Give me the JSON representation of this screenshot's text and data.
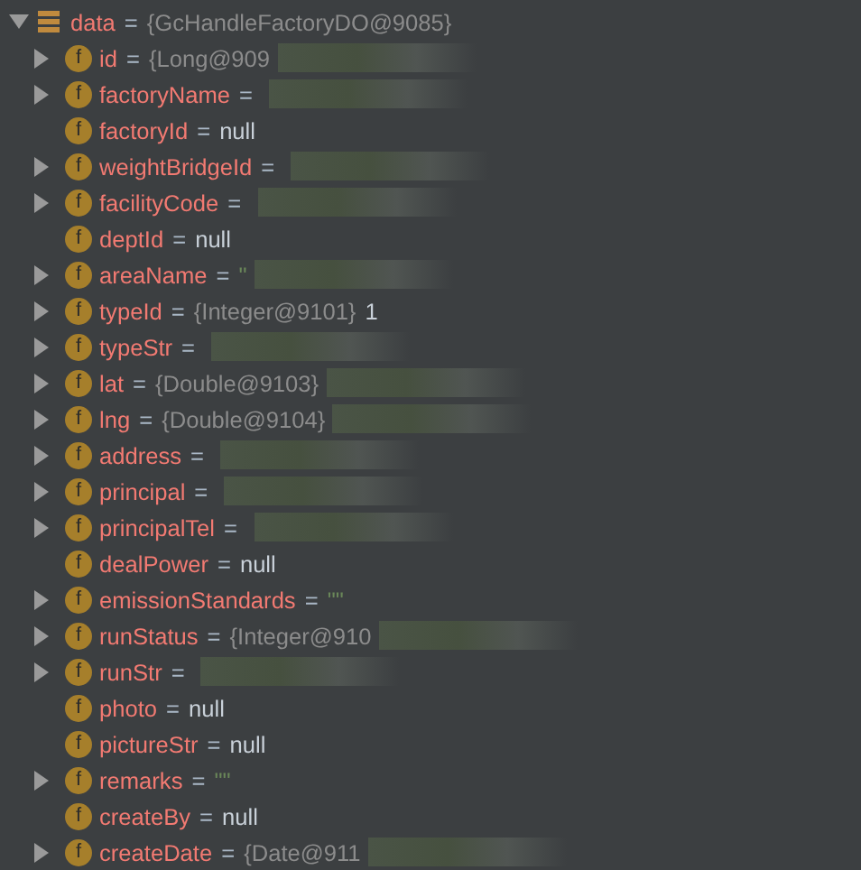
{
  "root": {
    "name": "data",
    "separator": "=",
    "value": "{GcHandleFactoryDO@9085}",
    "expanded": true
  },
  "fields": [
    {
      "badge": "f",
      "name": "id",
      "separator": "=",
      "value": "{Long@909",
      "kind": "object",
      "expandable": true,
      "redacted": true
    },
    {
      "badge": "f",
      "name": "factoryName",
      "separator": "=",
      "expandable": true,
      "redacted": true
    },
    {
      "badge": "f",
      "name": "factoryId",
      "separator": "=",
      "value": "null",
      "kind": "null",
      "expandable": false,
      "redacted": false
    },
    {
      "badge": "f",
      "name": "weightBridgeId",
      "separator": "=",
      "expandable": true,
      "redacted": true
    },
    {
      "badge": "f",
      "name": "facilityCode",
      "separator": "=",
      "expandable": true,
      "redacted": true
    },
    {
      "badge": "f",
      "name": "deptId",
      "separator": "=",
      "value": "null",
      "kind": "null",
      "expandable": false,
      "redacted": false
    },
    {
      "badge": "f",
      "name": "areaName",
      "separator": "=",
      "value": "\"",
      "kind": "string",
      "expandable": true,
      "redacted": true
    },
    {
      "badge": "f",
      "name": "typeId",
      "separator": "=",
      "value": "{Integer@9101}",
      "kind": "object",
      "extra": "1",
      "expandable": true,
      "redacted": false
    },
    {
      "badge": "f",
      "name": "typeStr",
      "separator": "=",
      "expandable": true,
      "redacted": true
    },
    {
      "badge": "f",
      "name": "lat",
      "separator": "=",
      "value": "{Double@9103}",
      "kind": "object",
      "expandable": true,
      "redacted": true
    },
    {
      "badge": "f",
      "name": "lng",
      "separator": "=",
      "value": "{Double@9104}",
      "kind": "object",
      "expandable": true,
      "redacted": true
    },
    {
      "badge": "f",
      "name": "address",
      "separator": "=",
      "expandable": true,
      "redacted": true
    },
    {
      "badge": "f",
      "name": "principal",
      "separator": "=",
      "expandable": true,
      "redacted": true
    },
    {
      "badge": "f",
      "name": "principalTel",
      "separator": "=",
      "expandable": true,
      "redacted": true
    },
    {
      "badge": "f",
      "name": "dealPower",
      "separator": "=",
      "value": "null",
      "kind": "null",
      "expandable": false,
      "redacted": false
    },
    {
      "badge": "f",
      "name": "emissionStandards",
      "separator": "=",
      "value": "\"\"",
      "kind": "string",
      "expandable": true,
      "redacted": false
    },
    {
      "badge": "f",
      "name": "runStatus",
      "separator": "=",
      "value": "{Integer@910",
      "kind": "object",
      "expandable": true,
      "redacted": true
    },
    {
      "badge": "f",
      "name": "runStr",
      "separator": "=",
      "expandable": true,
      "redacted": true
    },
    {
      "badge": "f",
      "name": "photo",
      "separator": "=",
      "value": "null",
      "kind": "null",
      "expandable": false,
      "redacted": false
    },
    {
      "badge": "f",
      "name": "pictureStr",
      "separator": "=",
      "value": "null",
      "kind": "null",
      "expandable": false,
      "redacted": false
    },
    {
      "badge": "f",
      "name": "remarks",
      "separator": "=",
      "value": "\"\"",
      "kind": "string",
      "expandable": true,
      "redacted": false
    },
    {
      "badge": "f",
      "name": "createBy",
      "separator": "=",
      "value": "null",
      "kind": "null",
      "expandable": false,
      "redacted": false
    },
    {
      "badge": "f",
      "name": "createDate",
      "separator": "=",
      "value": "{Date@911",
      "kind": "object",
      "expandable": true,
      "redacted": true
    }
  ]
}
